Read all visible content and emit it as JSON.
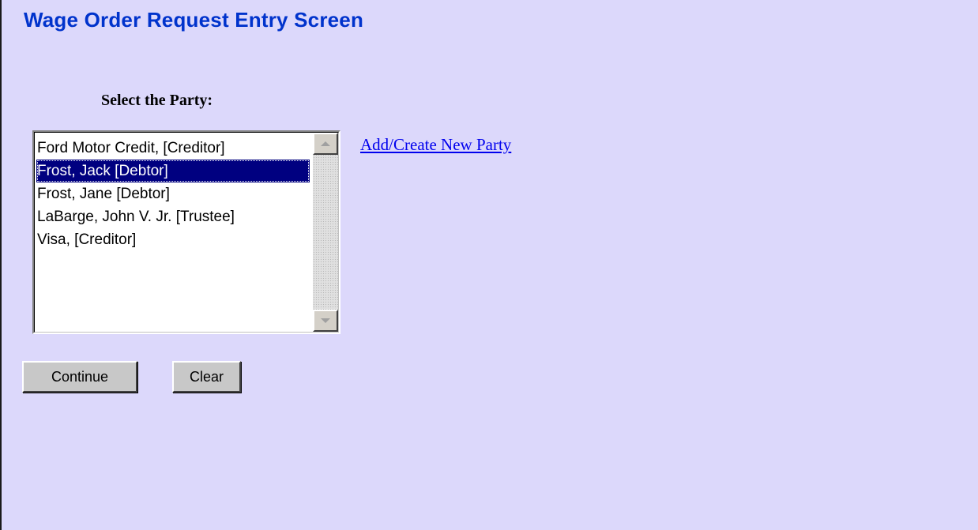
{
  "page": {
    "title": "Wage Order Request Entry Screen"
  },
  "form": {
    "party_label": "Select the Party:",
    "parties": [
      "Ford Motor Credit, [Creditor]",
      "Frost, Jack [Debtor]",
      "Frost, Jane [Debtor]",
      "LaBarge, John V. Jr. [Trustee]",
      "Visa, [Creditor]"
    ],
    "selected_party": "Frost, Jack [Debtor]",
    "add_party_link": "Add/Create New Party",
    "continue_label": "Continue",
    "clear_label": "Clear"
  },
  "icons": {
    "scroll_up": "scroll-up-arrow-icon",
    "scroll_down": "scroll-down-arrow-icon"
  },
  "colors": {
    "background": "#dcd8fb",
    "title": "#0033cc",
    "selection": "#000080",
    "link": "#0000ee"
  }
}
